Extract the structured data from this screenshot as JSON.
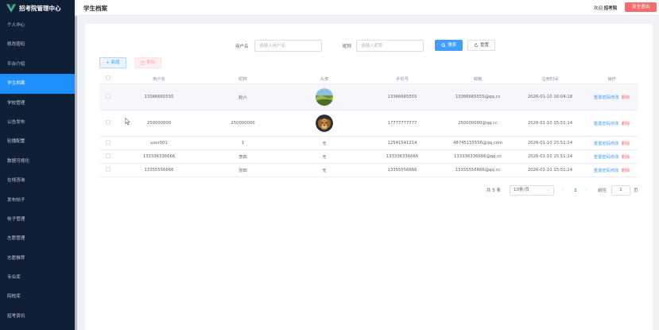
{
  "app": {
    "title": "招考院管理中心",
    "brand_color": "#42b983"
  },
  "sidebar": {
    "items": [
      {
        "label": "个人中心",
        "active": false
      },
      {
        "label": "修改密码",
        "active": false
      },
      {
        "label": "平台介绍",
        "active": false
      },
      {
        "label": "学生档案",
        "active": true
      },
      {
        "label": "学校管理",
        "active": false
      },
      {
        "label": "公告发布",
        "active": false
      },
      {
        "label": "轮播配置",
        "active": false
      },
      {
        "label": "数据可视化",
        "active": false
      },
      {
        "label": "在线咨询",
        "active": false
      },
      {
        "label": "发布帖子",
        "active": false
      },
      {
        "label": "帖子管理",
        "active": false
      },
      {
        "label": "志愿管理",
        "active": false
      },
      {
        "label": "志愿推荐",
        "active": false
      },
      {
        "label": "专业库",
        "active": false
      },
      {
        "label": "院校库",
        "active": false
      },
      {
        "label": "招考资讯",
        "active": false
      }
    ]
  },
  "header": {
    "page_title": "学生档案",
    "welcome_prefix": "欢迎,",
    "username": "招考院",
    "logout_label": "安全退出"
  },
  "search": {
    "username_label": "用户名",
    "username_placeholder": "请输入用户名",
    "nickname_label": "昵称",
    "nickname_placeholder": "请输入昵称",
    "search_label": "搜索",
    "reset_label": "重置"
  },
  "toolbar": {
    "add_label": "新增",
    "delete_label": "删除"
  },
  "table": {
    "columns": [
      "",
      "用户名",
      "昵称",
      "头像",
      "手机号",
      "邮箱",
      "注册时间",
      "操作"
    ],
    "rows": [
      {
        "username": "13366665555",
        "nickname": "赵六",
        "avatar": "landscape",
        "phone": "13366665555",
        "email": "13366665555@qq.cc",
        "reg_time": "2026-01-10 16:04:18",
        "highlight": true
      },
      {
        "username": "250000000",
        "nickname": "250000000",
        "avatar": "dog",
        "phone": "17777777777",
        "email": "250000000@qq.cc",
        "reg_time": "2026-01-10 15:51:14",
        "highlight": false
      },
      {
        "username": "user001",
        "nickname": "1",
        "avatar": "无",
        "phone": "12541541214",
        "email": "48745155556@qq.com",
        "reg_time": "2026-01-10 15:51:14",
        "highlight": false
      },
      {
        "username": "133336336666",
        "nickname": "李四",
        "avatar": "无",
        "phone": "133336336666",
        "email": "133336336666@qq.cc",
        "reg_time": "2026-01-10 15:51:14",
        "highlight": false
      },
      {
        "username": "13355556666",
        "nickname": "张四",
        "avatar": "无",
        "phone": "13355556666",
        "email": "13355556666@qq.cc",
        "reg_time": "2026-01-10 15:51:14",
        "highlight": false
      }
    ],
    "ops": {
      "reset_pwd": "重置密码",
      "edit": "修改",
      "delete": "删除"
    }
  },
  "pagination": {
    "total_text": "共 5 条",
    "page_size": "10条/页",
    "current_page": "1",
    "goto_label": "前往",
    "goto_value": "1",
    "page_suffix": "页"
  }
}
